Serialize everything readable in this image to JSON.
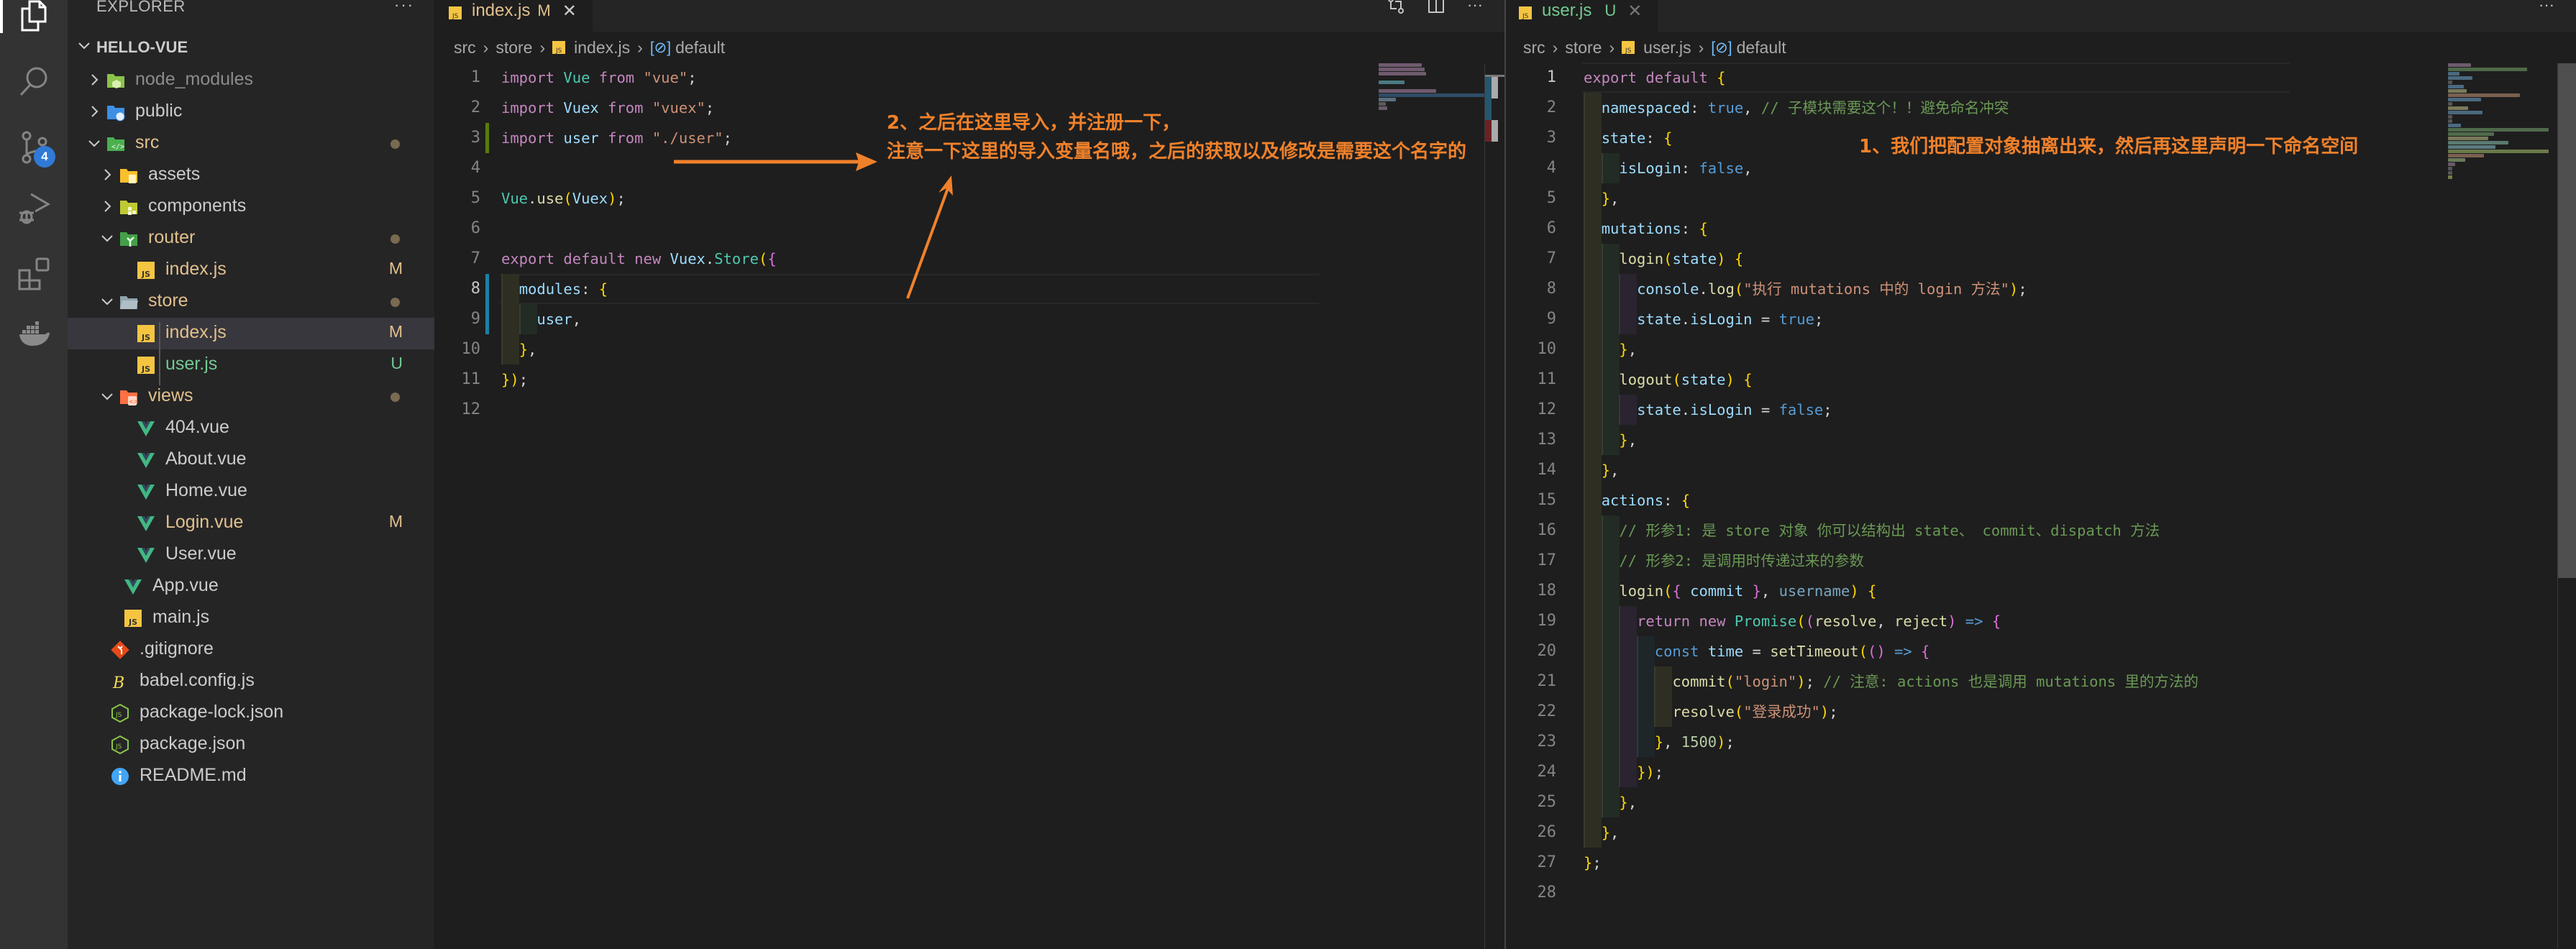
{
  "activity_bar": {
    "items": [
      {
        "icon": "files-icon",
        "label": "Explorer",
        "active": true
      },
      {
        "icon": "search-icon",
        "label": "Search"
      },
      {
        "icon": "source-control-icon",
        "label": "Source Control",
        "badge": "4"
      },
      {
        "icon": "run-debug-icon",
        "label": "Run and Debug"
      },
      {
        "icon": "extensions-icon",
        "label": "Extensions"
      },
      {
        "icon": "docker-icon",
        "label": "Docker"
      }
    ]
  },
  "sidebar": {
    "title": "EXPLORER",
    "more": "···",
    "root": "HELLO-VUE",
    "tree": [
      {
        "name": "node_modules",
        "depth": 1,
        "type": "folder",
        "expanded": false,
        "icon": "folder-node-icon",
        "status": "dim"
      },
      {
        "name": "public",
        "depth": 1,
        "type": "folder",
        "expanded": false,
        "icon": "folder-public-icon",
        "status": ""
      },
      {
        "name": "src",
        "depth": 1,
        "type": "folder",
        "expanded": true,
        "icon": "folder-src-icon",
        "status": "dot"
      },
      {
        "name": "assets",
        "depth": 2,
        "type": "folder",
        "expanded": false,
        "icon": "folder-assets-icon",
        "status": ""
      },
      {
        "name": "components",
        "depth": 2,
        "type": "folder",
        "expanded": false,
        "icon": "folder-components-icon",
        "status": ""
      },
      {
        "name": "router",
        "depth": 2,
        "type": "folder",
        "expanded": true,
        "icon": "folder-router-icon",
        "status": "dot"
      },
      {
        "name": "index.js",
        "depth": 3,
        "type": "file",
        "icon": "js-file-icon",
        "status": "M"
      },
      {
        "name": "store",
        "depth": 2,
        "type": "folder",
        "expanded": true,
        "icon": "folder-store-icon",
        "status": "dot"
      },
      {
        "name": "index.js",
        "depth": 3,
        "type": "file",
        "icon": "js-file-icon",
        "status": "M",
        "selected": true
      },
      {
        "name": "user.js",
        "depth": 3,
        "type": "file",
        "icon": "js-file-icon",
        "status": "U"
      },
      {
        "name": "views",
        "depth": 2,
        "type": "folder",
        "expanded": true,
        "icon": "folder-views-icon",
        "status": "dot"
      },
      {
        "name": "404.vue",
        "depth": 3,
        "type": "file",
        "icon": "vue-file-icon",
        "status": ""
      },
      {
        "name": "About.vue",
        "depth": 3,
        "type": "file",
        "icon": "vue-file-icon",
        "status": ""
      },
      {
        "name": "Home.vue",
        "depth": 3,
        "type": "file",
        "icon": "vue-file-icon",
        "status": ""
      },
      {
        "name": "Login.vue",
        "depth": 3,
        "type": "file",
        "icon": "vue-file-icon",
        "status": "M"
      },
      {
        "name": "User.vue",
        "depth": 3,
        "type": "file",
        "icon": "vue-file-icon",
        "status": ""
      },
      {
        "name": "App.vue",
        "depth": 2,
        "type": "file",
        "icon": "vue-file-icon",
        "status": ""
      },
      {
        "name": "main.js",
        "depth": 2,
        "type": "file",
        "icon": "js-file-icon",
        "status": ""
      },
      {
        "name": ".gitignore",
        "depth": 1,
        "type": "file",
        "icon": "git-file-icon",
        "status": ""
      },
      {
        "name": "babel.config.js",
        "depth": 1,
        "type": "file",
        "icon": "babel-file-icon",
        "status": ""
      },
      {
        "name": "package-lock.json",
        "depth": 1,
        "type": "file",
        "icon": "nodejs-file-icon",
        "status": ""
      },
      {
        "name": "package.json",
        "depth": 1,
        "type": "file",
        "icon": "nodejs-file-icon",
        "status": ""
      },
      {
        "name": "README.md",
        "depth": 1,
        "type": "file",
        "icon": "info-file-icon",
        "status": ""
      }
    ]
  },
  "editors": {
    "left": {
      "tab": {
        "name": "index.js",
        "decoration": "M",
        "close": "✕"
      },
      "breadcrumb": [
        "src",
        "store",
        "index.js",
        "default"
      ],
      "current_line": 8,
      "lines": [
        "import Vue from \"vue\";",
        "import Vuex from \"vuex\";",
        "import user from \"./user\";",
        "",
        "Vue.use(Vuex);",
        "",
        "export default new Vuex.Store({",
        "  modules: {",
        "    user,",
        "  },",
        "});",
        ""
      ]
    },
    "right": {
      "tab": {
        "name": "user.js",
        "decoration": "U",
        "close": "✕"
      },
      "breadcrumb": [
        "src",
        "store",
        "user.js",
        "default"
      ],
      "current_line": 1,
      "lines": [
        "export default {",
        "  namespaced: true, // 子模块需要这个！！避免命名冲突",
        "  state: {",
        "    isLogin: false,",
        "  },",
        "  mutations: {",
        "    login(state) {",
        "      console.log(\"执行 mutations 中的 login 方法\");",
        "      state.isLogin = true;",
        "    },",
        "    logout(state) {",
        "      state.isLogin = false;",
        "    },",
        "  },",
        "  actions: {",
        "    // 形参1: 是 store 对象 你可以结构出 state、 commit、dispatch 方法",
        "    // 形参2: 是调用时传递过来的参数",
        "    login({ commit }, username) {",
        "      return new Promise((resolve, reject) => {",
        "        const time = setTimeout(() => {",
        "          commit(\"login\"); // 注意: actions 也是调用 mutations 里的方法的",
        "          resolve(\"登录成功\");",
        "        }, 1500);",
        "      });",
        "    },",
        "  },",
        "};",
        ""
      ]
    }
  },
  "annotations": {
    "left_line1": "2、之后在这里导入，并注册一下，",
    "left_line2": "注意一下这里的导入变量名哦，之后的获取以及修改是需要这个名字的",
    "right": "1、我们把配置对象抽离出来，然后再这里声明一下命名空间"
  },
  "colors": {
    "annotation": "#f0812b",
    "modified": "#e2c08d",
    "untracked": "#73c991",
    "badge": "#2f7ad6"
  }
}
